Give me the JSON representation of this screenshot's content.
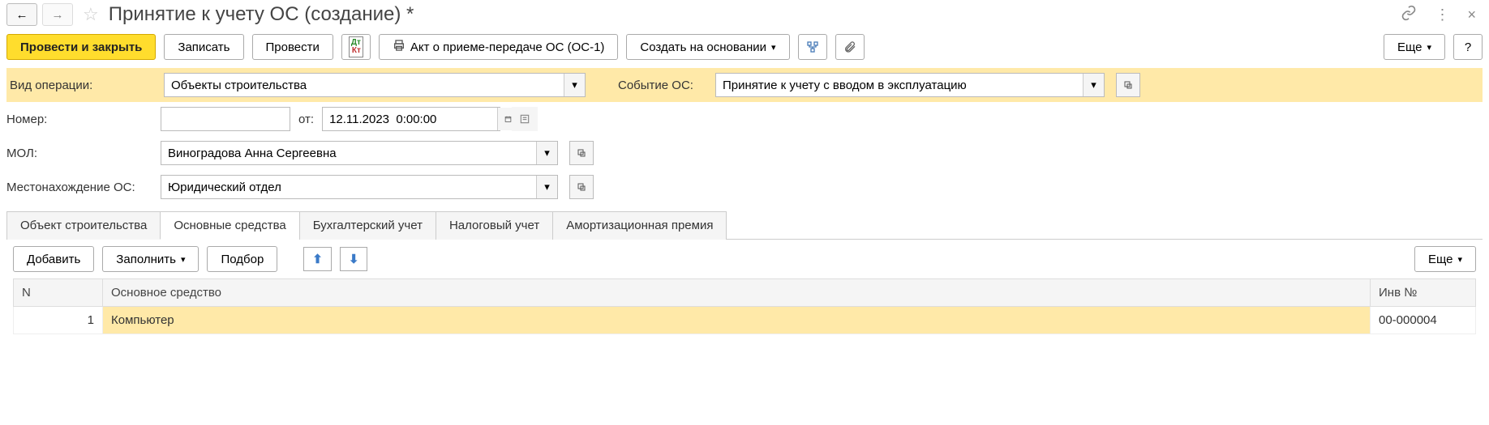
{
  "header": {
    "title": "Принятие к учету ОС (создание) *"
  },
  "toolbar": {
    "post_close": "Провести и закрыть",
    "write": "Записать",
    "post": "Провести",
    "act_os1": "Акт о приеме-передаче ОС (ОС-1)",
    "create_based": "Создать на основании",
    "more_label": "Еще"
  },
  "form": {
    "op_type_label": "Вид операции:",
    "op_type_value": "Объекты строительства",
    "event_label": "Событие ОС:",
    "event_value": "Принятие к учету с вводом в эксплуатацию",
    "number_label": "Номер:",
    "number_value": "",
    "from_label": "от:",
    "date_value": "12.11.2023  0:00:00",
    "mol_label": "МОЛ:",
    "mol_value": "Виноградова Анна Сергеевна",
    "location_label": "Местонахождение ОС:",
    "location_value": "Юридический отдел"
  },
  "tabs": {
    "t1": "Объект строительства",
    "t2": "Основные средства",
    "t3": "Бухгалтерский учет",
    "t4": "Налоговый учет",
    "t5": "Амортизационная премия"
  },
  "tab_toolbar": {
    "add": "Добавить",
    "fill": "Заполнить",
    "select": "Подбор",
    "more": "Еще"
  },
  "table": {
    "col_n": "N",
    "col_os": "Основное средство",
    "col_inv": "Инв №",
    "rows": [
      {
        "n": "1",
        "name": "Компьютер",
        "inv": "00-000004"
      }
    ]
  }
}
